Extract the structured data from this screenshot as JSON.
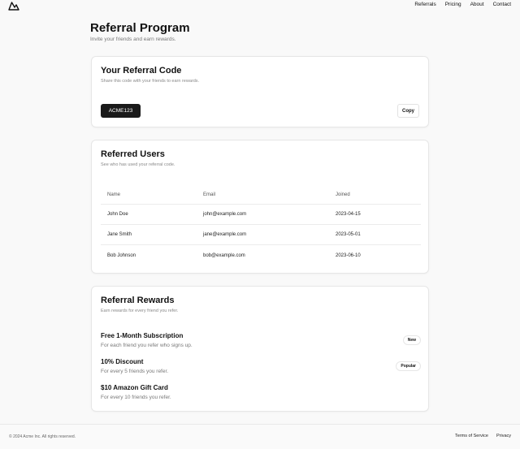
{
  "header": {
    "logo_icon": "mountain-logo-icon",
    "nav": [
      "Referrals",
      "Pricing",
      "About",
      "Contact"
    ]
  },
  "page": {
    "title": "Referral Program",
    "subtitle": "Invite your friends and earn rewards."
  },
  "referral_code_card": {
    "title": "Your Referral Code",
    "subtitle": "Share this code with your friends to earn rewards.",
    "code": "ACME123",
    "copy_label": "Copy"
  },
  "referred_users_card": {
    "title": "Referred Users",
    "subtitle": "See who has used your referral code.",
    "columns": [
      "Name",
      "Email",
      "Joined"
    ],
    "rows": [
      {
        "name": "John Doe",
        "email": "john@example.com",
        "joined": "2023-04-15"
      },
      {
        "name": "Jane Smith",
        "email": "jane@example.com",
        "joined": "2023-05-01"
      },
      {
        "name": "Bob Johnson",
        "email": "bob@example.com",
        "joined": "2023-06-10"
      }
    ]
  },
  "rewards_card": {
    "title": "Referral Rewards",
    "subtitle": "Earn rewards for every friend you refer.",
    "items": [
      {
        "title": "Free 1-Month Subscription",
        "desc": "For each friend you refer who signs up.",
        "badge": "New"
      },
      {
        "title": "10% Discount",
        "desc": "For every 5 friends you refer.",
        "badge": "Popular"
      },
      {
        "title": "$10 Amazon Gift Card",
        "desc": "For every 10 friends you refer.",
        "badge": ""
      }
    ]
  },
  "footer": {
    "copyright": "© 2024 Acme Inc. All rights reserved.",
    "links": [
      "Terms of Service",
      "Privacy"
    ]
  }
}
